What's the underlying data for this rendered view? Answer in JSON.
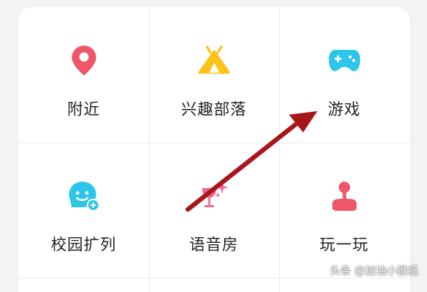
{
  "menu": {
    "items": [
      {
        "label": "附近",
        "icon": "location-pin-icon",
        "color": "#f0566a"
      },
      {
        "label": "兴趣部落",
        "icon": "tent-icon",
        "color": "#ffc21a"
      },
      {
        "label": "游戏",
        "icon": "gamepad-icon",
        "color": "#2bc6e8"
      },
      {
        "label": "校园扩列",
        "icon": "smiley-add-icon",
        "color": "#2bc6e8"
      },
      {
        "label": "语音房",
        "icon": "microphone-sparkle-icon",
        "color": "#f06b9a"
      },
      {
        "label": "玩一玩",
        "icon": "joystick-icon",
        "color": "#f0566a"
      }
    ]
  },
  "annotation": {
    "arrow_color": "#a8161c"
  },
  "watermark": {
    "text": "头条 @加油小猴纸"
  }
}
